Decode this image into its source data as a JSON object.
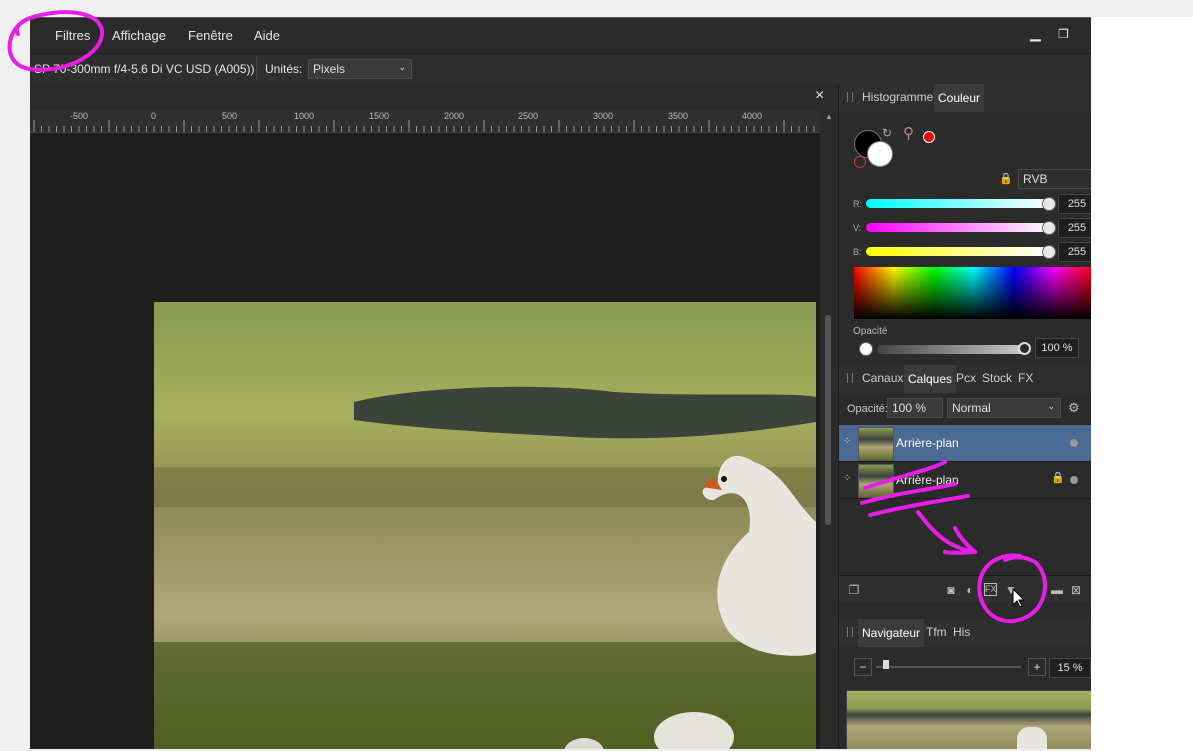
{
  "menu": {
    "items": [
      "Filtres",
      "Affichage",
      "Fenêtre",
      "Aide"
    ],
    "minimize": "▁",
    "restore": "❐"
  },
  "context_bar": {
    "lens_text": "SP 70-300mm f/4-5.6 Di VC USD (A005))",
    "units_label": "Unités:",
    "units_value": "Pixels"
  },
  "document": {
    "close_glyph": "×",
    "ruler_labels": [
      "-500",
      "0",
      "500",
      "1000",
      "1500",
      "2000",
      "2500",
      "3000",
      "3500",
      "4000"
    ]
  },
  "color_panel": {
    "tabs": [
      "Histogramme",
      "Couleur"
    ],
    "active_tab": "Couleur",
    "model": "RVB",
    "channels": [
      {
        "label": "R:",
        "value": "255"
      },
      {
        "label": "V:",
        "value": "255"
      },
      {
        "label": "B:",
        "value": "255"
      }
    ],
    "opacity_label": "Opacité",
    "opacity_value": "100 %"
  },
  "layers_panel": {
    "tabs": [
      "Canaux",
      "Calques",
      "Pcx",
      "Stock",
      "FX"
    ],
    "active_tab": "Calques",
    "opacity_label": "Opacité:",
    "opacity_value": "100 %",
    "blend_mode": "Normal",
    "layers": [
      {
        "name": "Arrière-plan",
        "selected": true,
        "locked": false
      },
      {
        "name": "Arrière-plan",
        "selected": false,
        "locked": true
      }
    ]
  },
  "navigator_panel": {
    "tabs": [
      "Navigateur",
      "Tfm",
      "His"
    ],
    "active_tab": "Navigateur",
    "zoom_value": "15 %",
    "zoom_out": "−",
    "zoom_in": "+"
  },
  "colors": {
    "accent_selected_layer": "#4a6a94",
    "annotation": "#e81ee8"
  }
}
